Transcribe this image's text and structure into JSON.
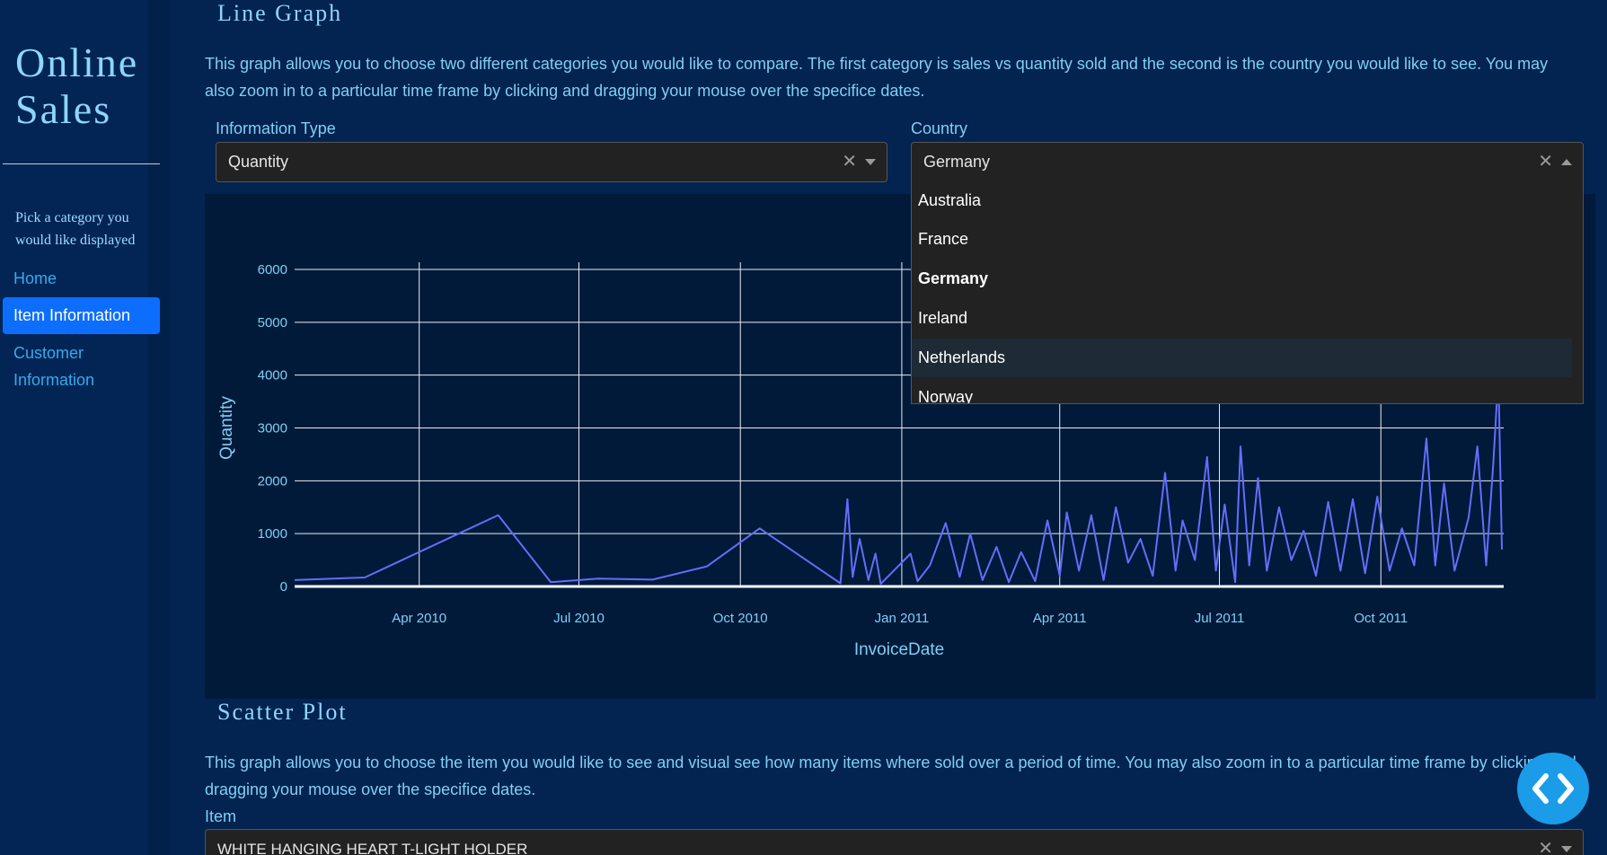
{
  "sidebar": {
    "brand_line1": "Online",
    "brand_line2": "Sales",
    "hint": "Pick a category you would like displayed",
    "nav": [
      {
        "label": "Home"
      },
      {
        "label": "Item Information",
        "active": true
      },
      {
        "label": "Customer Information"
      }
    ]
  },
  "line_section": {
    "title": "Line Graph",
    "description": "This graph allows you to choose two different categories you would like to compare. The first category is sales vs quantity sold and the second is the country you would like to see. You may also zoom in to a particular time frame by clicking and dragging your mouse over the specifice dates.",
    "info_type_label": "Information Type",
    "info_type_value": "Quantity",
    "country_label": "Country",
    "country_value": "Germany",
    "country_options": [
      "Australia",
      "France",
      "Germany",
      "Ireland",
      "Netherlands",
      "Norway"
    ],
    "country_selected": "Germany",
    "country_hovered": "Netherlands"
  },
  "scatter_section": {
    "title": "Scatter Plot",
    "description": "This graph allows you to choose the item you would like to see and visual see how many items where sold over a period of time. You may also zoom in to a particular time frame by clicking and dragging your mouse over the specifice dates.",
    "item_label": "Item",
    "item_value": "WHITE HANGING HEART T-LIGHT HOLDER"
  },
  "colors": {
    "background": "#032350",
    "sidebar": "#022556",
    "plot_bg": "#011a3a",
    "line": "#636efa",
    "accent": "#0d6efd",
    "text": "#7fd0f5"
  },
  "icons": {
    "clear": "x-icon",
    "caret": "caret-down-icon",
    "fab": "code-icon"
  },
  "chart_data": {
    "type": "line",
    "xlabel": "InvoiceDate",
    "ylabel": "Quantity",
    "x_ticks": [
      "Apr 2010",
      "Jul 2010",
      "Oct 2010",
      "Jan 2011",
      "Apr 2011",
      "Jul 2011",
      "Oct 2011"
    ],
    "y_ticks": [
      0,
      1000,
      2000,
      3000,
      4000,
      5000,
      6000
    ],
    "ylim": [
      0,
      6000
    ],
    "xlim": [
      "2010-01-20",
      "2011-12-10"
    ],
    "grid": true,
    "series": [
      {
        "points": [
          [
            "2010-01-20",
            120
          ],
          [
            "2010-03-01",
            170
          ],
          [
            "2010-05-16",
            1350
          ],
          [
            "2010-06-15",
            80
          ],
          [
            "2010-07-12",
            150
          ],
          [
            "2010-08-12",
            130
          ],
          [
            "2010-09-12",
            380
          ],
          [
            "2010-10-12",
            1100
          ],
          [
            "2010-11-27",
            60
          ],
          [
            "2010-12-01",
            1650
          ],
          [
            "2010-12-04",
            180
          ],
          [
            "2010-12-08",
            900
          ],
          [
            "2010-12-13",
            120
          ],
          [
            "2010-12-17",
            620
          ],
          [
            "2010-12-20",
            50
          ],
          [
            "2011-01-06",
            620
          ],
          [
            "2011-01-10",
            100
          ],
          [
            "2011-01-17",
            400
          ],
          [
            "2011-01-26",
            1200
          ],
          [
            "2011-02-03",
            180
          ],
          [
            "2011-02-09",
            1000
          ],
          [
            "2011-02-16",
            120
          ],
          [
            "2011-02-24",
            750
          ],
          [
            "2011-03-03",
            80
          ],
          [
            "2011-03-10",
            650
          ],
          [
            "2011-03-18",
            100
          ],
          [
            "2011-03-25",
            1250
          ],
          [
            "2011-04-01",
            200
          ],
          [
            "2011-04-05",
            1400
          ],
          [
            "2011-04-12",
            300
          ],
          [
            "2011-04-19",
            1350
          ],
          [
            "2011-04-26",
            120
          ],
          [
            "2011-05-03",
            1500
          ],
          [
            "2011-05-10",
            450
          ],
          [
            "2011-05-17",
            900
          ],
          [
            "2011-05-24",
            200
          ],
          [
            "2011-05-31",
            2150
          ],
          [
            "2011-06-06",
            300
          ],
          [
            "2011-06-10",
            1250
          ],
          [
            "2011-06-17",
            500
          ],
          [
            "2011-06-24",
            2450
          ],
          [
            "2011-06-29",
            300
          ],
          [
            "2011-07-04",
            1550
          ],
          [
            "2011-07-10",
            80
          ],
          [
            "2011-07-13",
            2650
          ],
          [
            "2011-07-18",
            400
          ],
          [
            "2011-07-23",
            2050
          ],
          [
            "2011-07-28",
            300
          ],
          [
            "2011-08-04",
            1500
          ],
          [
            "2011-08-11",
            500
          ],
          [
            "2011-08-18",
            1050
          ],
          [
            "2011-08-25",
            200
          ],
          [
            "2011-09-01",
            1600
          ],
          [
            "2011-09-08",
            300
          ],
          [
            "2011-09-15",
            1650
          ],
          [
            "2011-09-22",
            250
          ],
          [
            "2011-09-29",
            1700
          ],
          [
            "2011-10-06",
            300
          ],
          [
            "2011-10-13",
            1100
          ],
          [
            "2011-10-20",
            400
          ],
          [
            "2011-10-27",
            2800
          ],
          [
            "2011-11-01",
            400
          ],
          [
            "2011-11-06",
            1950
          ],
          [
            "2011-11-12",
            300
          ],
          [
            "2011-11-20",
            1300
          ],
          [
            "2011-11-25",
            2650
          ],
          [
            "2011-11-30",
            400
          ],
          [
            "2011-12-04",
            2300
          ],
          [
            "2011-12-07",
            4000
          ],
          [
            "2011-12-09",
            700
          ]
        ]
      }
    ]
  }
}
